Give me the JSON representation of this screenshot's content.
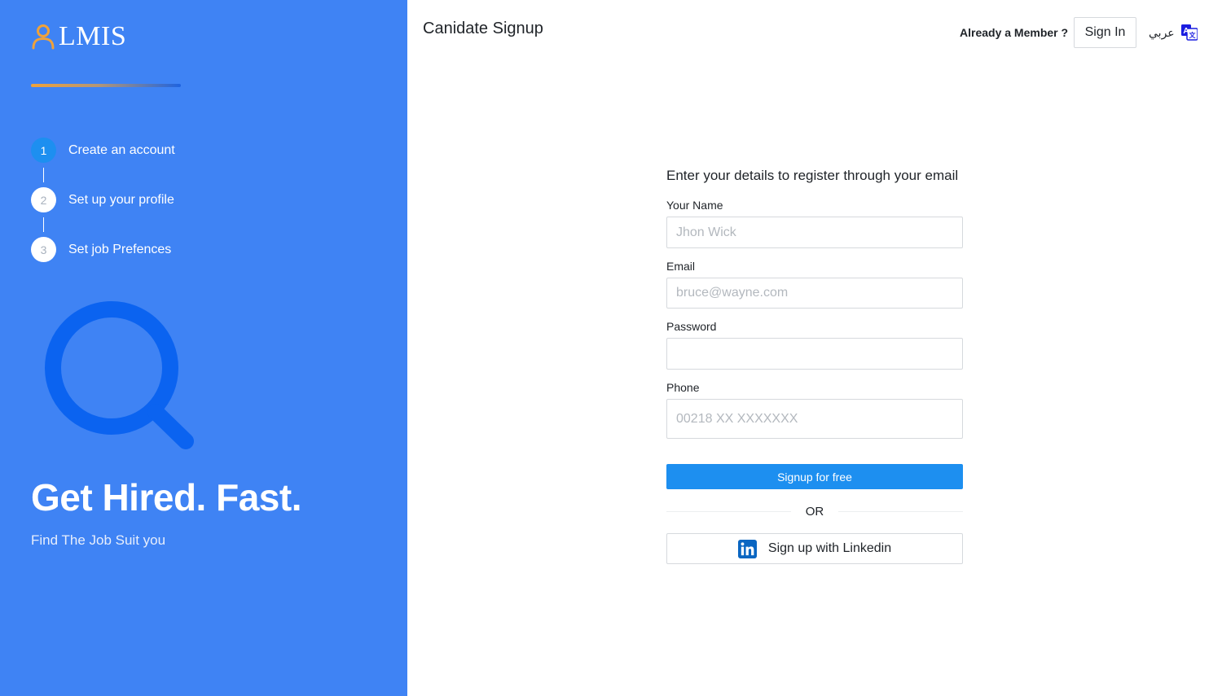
{
  "brand": {
    "name": "LMIS",
    "accent": "#3f83f4",
    "logo_color": "#f0a23a"
  },
  "steps": [
    {
      "number": "1",
      "label": "Create an account",
      "active": true
    },
    {
      "number": "2",
      "label": "Set up your profile",
      "active": false
    },
    {
      "number": "3",
      "label": "Set job Prefences",
      "active": false
    }
  ],
  "hero": {
    "title": "Get Hired. Fast.",
    "subtitle": "Find The Job Suit you",
    "icon": "magnifier-icon"
  },
  "header": {
    "title": "Canidate Signup",
    "member_text": "Already a Member ?",
    "signin_label": "Sign In",
    "language_label": "عربي",
    "language_icon": "translate-icon"
  },
  "form": {
    "heading": "Enter your details to register through your email",
    "name": {
      "label": "Your Name",
      "placeholder": "Jhon Wick",
      "value": ""
    },
    "email": {
      "label": "Email",
      "placeholder": "bruce@wayne.com",
      "value": ""
    },
    "password": {
      "label": "Password",
      "placeholder": "",
      "value": ""
    },
    "phone": {
      "label": "Phone",
      "placeholder": "00218 XX XXXXXXX",
      "value": ""
    },
    "submit_label": "Signup for free",
    "divider_text": "OR",
    "linkedin_label": "Sign up with Linkedin",
    "primary_color": "#1d8ff0"
  }
}
